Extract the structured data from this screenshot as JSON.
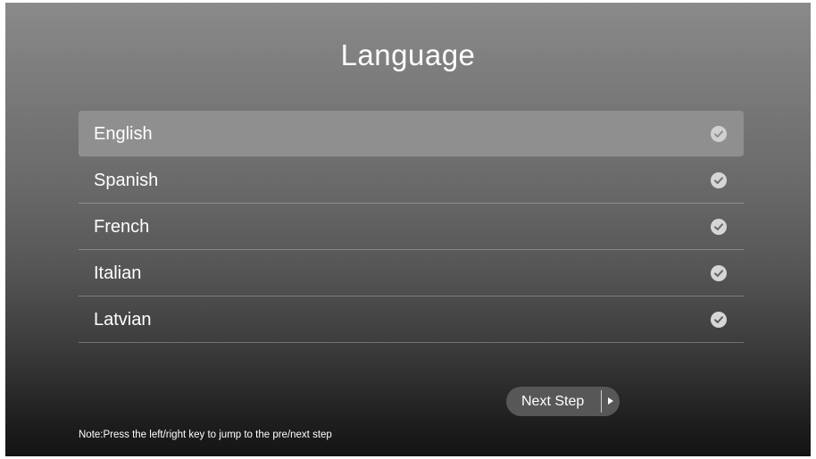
{
  "screen": {
    "title": "Language"
  },
  "languages": [
    {
      "label": "English",
      "selected": true
    },
    {
      "label": "Spanish",
      "selected": false
    },
    {
      "label": "French",
      "selected": false
    },
    {
      "label": "Italian",
      "selected": false
    },
    {
      "label": "Latvian",
      "selected": false
    }
  ],
  "icons": {
    "check": "check-circle-icon",
    "next": "play-arrow-icon"
  },
  "next_button": {
    "label": "Next Step"
  },
  "note": "Note:Press the left/right key to jump to the pre/next step"
}
